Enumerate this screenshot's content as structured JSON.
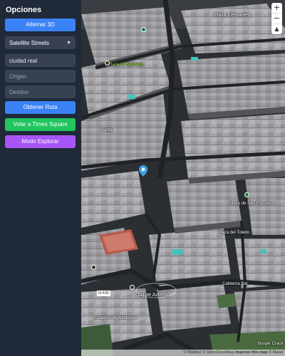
{
  "sidebar": {
    "title": "Opciones",
    "toggle_3d_label": "Alternar 3D",
    "style_select": {
      "value": "Satellite Streets",
      "options": [
        "Satellite Streets"
      ]
    },
    "search_value": "ciudad real",
    "origin_placeholder": "Origen",
    "destination_placeholder": "Destino",
    "route_button_label": "Obtener Ruta",
    "fly_button_label": "Volar a Times Square",
    "explore_button_label": "Modo Explorar"
  },
  "colors": {
    "sidebar_bg": "#1f2937",
    "blue_button": "#3b82f6",
    "green_button": "#22c55e",
    "purple_button": "#a855f7",
    "marker": "#3aa3e0"
  },
  "map": {
    "labels": {
      "plaza_cervantes": "Plaza Cervantes",
      "plaza_santiago": "Plaza de Santiago",
      "plaza_san_francisco": "Plaza de San Francisco",
      "quijote_azteca": "Quijote Azteca",
      "cafeteria_bar": "Cafetería Bar",
      "plaza_toledo": "Plaza del Toledo",
      "burger": "Burger Crack",
      "santa": "Santa",
      "estacion": "Estación de Autobuses"
    },
    "road_shield": "N-430",
    "zoom_in": "+",
    "zoom_out": "−",
    "compass": "▲"
  },
  "attribution": {
    "mapbox": "© Mapbox",
    "osm": "© OpenStreetMap",
    "improve": "Improve this map",
    "maxar": "© Maxar"
  }
}
